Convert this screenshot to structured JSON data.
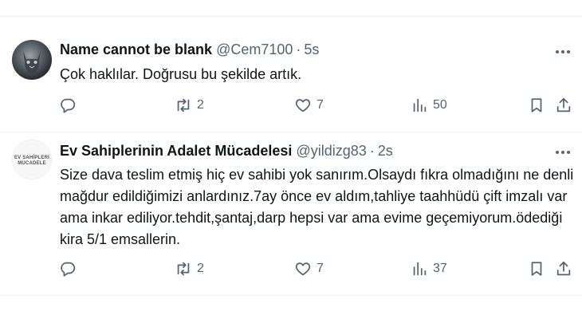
{
  "tweets": [
    {
      "display_name": "Name cannot be blank",
      "handle": "@Cem7100",
      "dot": "·",
      "time": "5s",
      "text": "Çok haklılar. Doğrusu bu şekilde artık.",
      "replies": "",
      "retweets": "2",
      "likes": "7",
      "views": "50",
      "avatar_icon": "cat-avatar"
    },
    {
      "display_name": "Ev Sahiplerinin Adalet Mücadelesi",
      "handle": "@yildizg83",
      "dot": "·",
      "time": "2s",
      "text": "Size dava teslim etmiş hiç ev sahibi yok sanırım.Olsaydı fıkra olmadığını ne denli mağdur edildiğimizi anlardınız.7ay önce ev aldım,tahliye taahhüdü çift imzalı var ama inkar ediliyor.tehdit,şantaj,darp hepsi var ama evime geçemiyorum.ödediği kira 5/1 emsallerin.",
      "replies": "",
      "retweets": "2",
      "likes": "7",
      "views": "37",
      "avatar_logo_text": "EV SAHİPLERİ MÜCADELE",
      "avatar_icon": "organization-logo"
    }
  ],
  "icons": {
    "reply": "reply-icon",
    "retweet": "retweet-icon",
    "like": "heart-icon",
    "views": "views-icon",
    "bookmark": "bookmark-icon",
    "share": "share-icon",
    "more": "more-icon"
  },
  "colors": {
    "text": "#0f1419",
    "secondary": "#536471",
    "divider": "#eff3f4",
    "background": "#ffffff"
  }
}
